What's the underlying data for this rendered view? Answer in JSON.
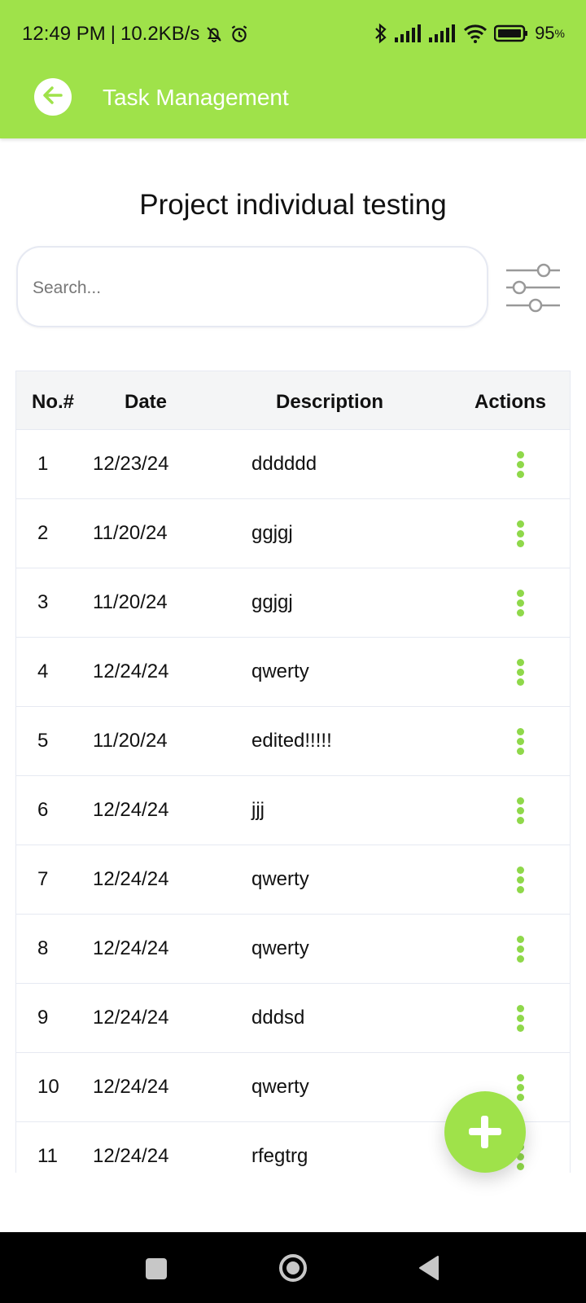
{
  "status_bar": {
    "time": "12:49 PM",
    "speed": "10.2KB/s",
    "battery": "95"
  },
  "toolbar": {
    "title": "Task Management"
  },
  "page": {
    "title": "Project individual testing"
  },
  "search": {
    "placeholder": "Search..."
  },
  "table": {
    "headers": {
      "no": "No.#",
      "date": "Date",
      "description": "Description",
      "actions": "Actions"
    },
    "rows": [
      {
        "no": "1",
        "date": "12/23/24",
        "description": "dddddd"
      },
      {
        "no": "2",
        "date": "11/20/24",
        "description": "ggjgj"
      },
      {
        "no": "3",
        "date": "11/20/24",
        "description": "ggjgj"
      },
      {
        "no": "4",
        "date": "12/24/24",
        "description": "qwerty"
      },
      {
        "no": "5",
        "date": "11/20/24",
        "description": "edited!!!!!"
      },
      {
        "no": "6",
        "date": "12/24/24",
        "description": "jjj"
      },
      {
        "no": "7",
        "date": "12/24/24",
        "description": "qwerty"
      },
      {
        "no": "8",
        "date": "12/24/24",
        "description": "qwerty"
      },
      {
        "no": "9",
        "date": "12/24/24",
        "description": "dddsd"
      },
      {
        "no": "10",
        "date": "12/24/24",
        "description": "qwerty"
      },
      {
        "no": "11",
        "date": "12/24/24",
        "description": "rfegtrg"
      }
    ]
  },
  "colors": {
    "accent": "#9fe24a",
    "action_dots": "#8fd84a",
    "nav_bar": "#000000"
  },
  "icons": {
    "back": "arrow-left-icon",
    "filter": "sliders-icon",
    "row_action": "more-vertical-icon",
    "add": "plus-icon"
  }
}
